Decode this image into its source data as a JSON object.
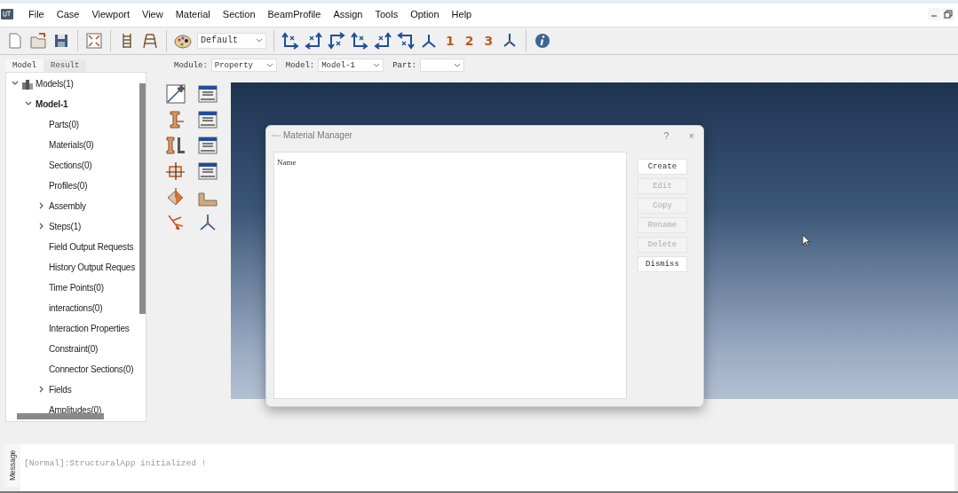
{
  "menu": [
    "File",
    "Case",
    "Viewport",
    "View",
    "Material",
    "Section",
    "BeamProfile",
    "Assign",
    "Tools",
    "Option",
    "Help"
  ],
  "toolbar": {
    "display_combo": "Default",
    "view_buttons": [
      "1",
      "2",
      "3"
    ]
  },
  "panel_tabs": [
    {
      "label": "Model",
      "selected": true
    },
    {
      "label": "Result",
      "selected": false
    }
  ],
  "tree": [
    {
      "label": "Models(1)",
      "expanded": true,
      "children": [
        {
          "label": "Model-1",
          "expanded": true,
          "active": true,
          "children": [
            {
              "label": "Parts(0)"
            },
            {
              "label": "Materials(0)"
            },
            {
              "label": "Sections(0)"
            },
            {
              "label": "Profiles(0)"
            },
            {
              "label": "Assembly",
              "expanded": false
            },
            {
              "label": "Steps(1)",
              "expanded": false
            },
            {
              "label": "Field Output Requests"
            },
            {
              "label": "History Output Reques"
            },
            {
              "label": "Time Points(0)"
            },
            {
              "label": "interactions(0)"
            },
            {
              "label": "Interaction Properties"
            },
            {
              "label": "Constraint(0)"
            },
            {
              "label": "Connector Sections(0)"
            },
            {
              "label": "Fields",
              "expanded": false
            },
            {
              "label": "Amplitudes(0)"
            }
          ]
        }
      ]
    }
  ],
  "context_bar": [
    {
      "label": "Module:",
      "value": "Property"
    },
    {
      "label": "Model:",
      "value": "Model-1"
    },
    {
      "label": "Part:"
    }
  ],
  "dialog": {
    "title": "Material Manager",
    "help": "?",
    "close": "×",
    "list_header": "Name",
    "buttons": [
      {
        "label": "Create",
        "disabled": false
      },
      {
        "label": "Edit",
        "disabled": true
      },
      {
        "label": "Copy",
        "disabled": true
      },
      {
        "label": "Rename",
        "disabled": true
      },
      {
        "label": "Delete",
        "disabled": true
      },
      {
        "label": "Dismiss",
        "disabled": false
      }
    ]
  },
  "message": {
    "tab": "Message",
    "text": "[Normal]:StructuralApp initialized !"
  }
}
